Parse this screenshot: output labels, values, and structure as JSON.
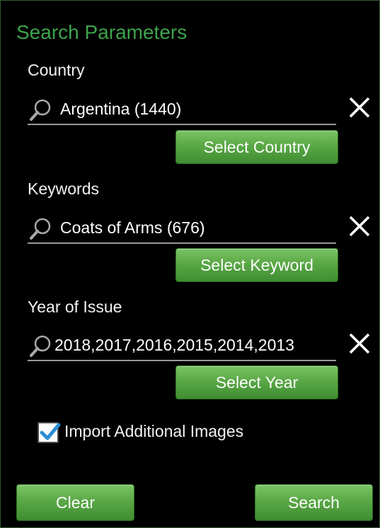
{
  "title": "Search Parameters",
  "country": {
    "label": "Country",
    "value": "Argentina (1440)",
    "select_label": "Select Country"
  },
  "keywords": {
    "label": "Keywords",
    "value": "Coats of Arms (676)",
    "select_label": "Select Keyword"
  },
  "year": {
    "label": "Year of Issue",
    "value": "2018,2017,2016,2015,2014,2013",
    "select_label": "Select Year"
  },
  "import_images": {
    "label": "Import Additional Images",
    "checked": true
  },
  "footer": {
    "clear_label": "Clear",
    "search_label": "Search"
  },
  "colors": {
    "title": "#3fa34d",
    "button_green": "#5aa846",
    "checkbox_blue": "#2a8fd6"
  },
  "icons": [
    "search-icon",
    "close-icon",
    "checkmark-icon"
  ]
}
